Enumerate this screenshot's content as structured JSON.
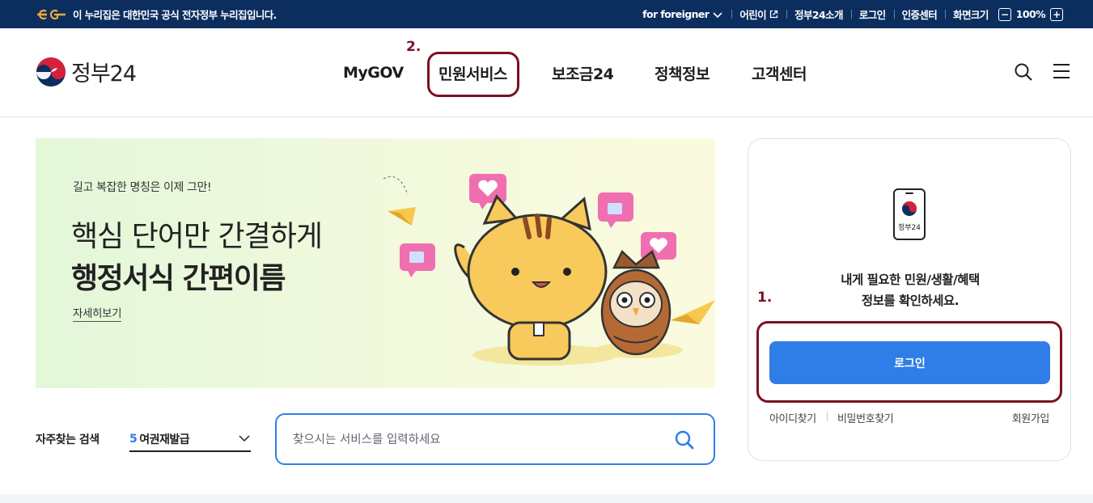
{
  "topbar": {
    "notice": "이 누리집은 대한민국 공식 전자정부 누리집입니다.",
    "foreigner": "for foreigner",
    "kids": "어린이",
    "about": "정부24소개",
    "login": "로그인",
    "cert": "인증센터",
    "zoom_label": "화면크기",
    "zoom_minus": "−",
    "zoom_value": "100%",
    "zoom_plus": "+"
  },
  "header": {
    "logo_text": "정부24",
    "nav": [
      "MyGOV",
      "민원서비스",
      "보조금24",
      "정책정보",
      "고객센터"
    ]
  },
  "annotations": {
    "step1": "1.",
    "step2": "2."
  },
  "banner": {
    "subtitle": "길고 복잡한 명칭은 이제 그만!",
    "title_line1": "핵심 단어만 간결하게",
    "title_line2": "행정서식 간편이름",
    "more_link": "자세히보기"
  },
  "login_panel": {
    "device_label": "정부24",
    "message_line1": "내게 필요한 민원/생활/혜택",
    "message_line2": "정보를 확인하세요.",
    "login_button": "로그인",
    "find_id": "아이디찾기",
    "find_pw": "비밀번호찾기",
    "signup": "회원가입"
  },
  "search": {
    "label": "자주찾는 검색",
    "rank": "5",
    "keyword": "여권재발급",
    "placeholder": "찾으시는 서비스를 입력하세요"
  },
  "colors": {
    "topbar_bg": "#0b2e5f",
    "accent_blue": "#2f7ee8",
    "annotation_red": "#7d1023"
  }
}
